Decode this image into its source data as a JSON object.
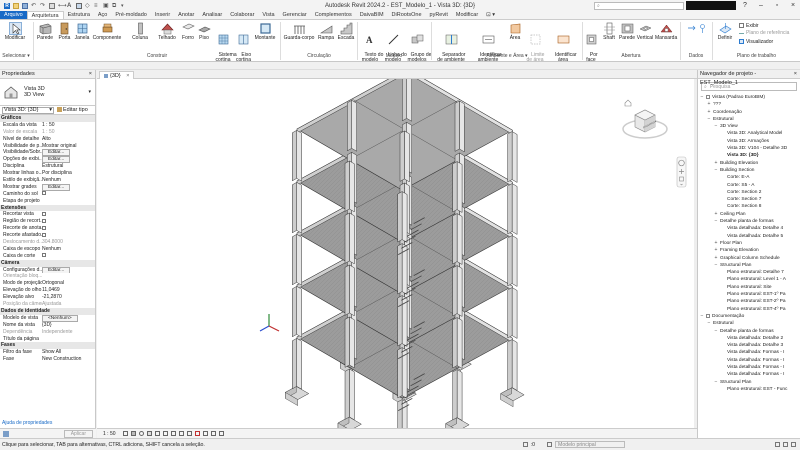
{
  "app": {
    "title": "Autodesk Revit 2024.2 - EST_Modelo_1 - Vista 3D: {3D}",
    "search_placeholder": "",
    "accent": "#1769c6"
  },
  "tabs": [
    {
      "label": "Arquivo"
    },
    {
      "label": "Arquitetura"
    },
    {
      "label": "Estrutura"
    },
    {
      "label": "Aço"
    },
    {
      "label": "Pré-moldado"
    },
    {
      "label": "Inserir"
    },
    {
      "label": "Anotar"
    },
    {
      "label": "Analisar"
    },
    {
      "label": "Colaborar"
    },
    {
      "label": "Vista"
    },
    {
      "label": "Gerenciar"
    },
    {
      "label": "Complementos"
    },
    {
      "label": "DaivaBIM"
    },
    {
      "label": "DiRootsOne"
    },
    {
      "label": "pyRevit"
    },
    {
      "label": "Modificar"
    },
    {
      "label": "⊡ ▾"
    }
  ],
  "ribbon": {
    "select_btn": "Modificar",
    "select_panel": "Selecionar ▾",
    "build": {
      "label": "Construir",
      "wall": "Parede",
      "door": "Porta",
      "window": "Janela",
      "component": "Componente",
      "column": "Coluna",
      "roof": "Telhado",
      "ceiling": "Forro",
      "floor": "Piso",
      "curtain_system": "Sistema\ncortina",
      "curtain_grid": "Eixo\ncortina",
      "mullion": "Montante"
    },
    "circulation": {
      "label": "Circulação",
      "railing": "Guarda-corpo",
      "ramp": "Rampa",
      "stair": "Escada"
    },
    "model": {
      "label": "Modelo",
      "model_text": "Texto do\nmodelo",
      "model_line": "Linha do\nmodelo",
      "model_group": "Grupo de\nmodelos"
    },
    "room": {
      "label": "Ambiente e Área ▾",
      "room_separator": "Separador\nde ambiente",
      "tag_room": "Identificar\nambiente",
      "area": "Área",
      "area_boundary": "Limite\nde área",
      "tag_area": "Identificar\nárea"
    },
    "opening": {
      "label": "Abertura",
      "by_face": "Por\nface",
      "shaft": "Shaft",
      "wall": "Parede",
      "vertical": "Vertical",
      "dormer": "Mansarda"
    },
    "datum": {
      "label": "Dados"
    },
    "workplane": {
      "label": "Plano de trabalho",
      "set": "Definir",
      "show": "Exibir",
      "ref_plane": "Plano de referência",
      "viewer": "Visualizador"
    }
  },
  "properties": {
    "title": "Propriedades",
    "type_name": "Vista 3D",
    "type_sub": "3D View",
    "view_selector": "Vista 3D: {3D}",
    "edit_type": "Editar tipo",
    "rows": [
      {
        "kind": "group",
        "k": "Gráficos",
        "v": ""
      },
      {
        "kind": "text",
        "k": "Escala da vista",
        "v": "1 : 50"
      },
      {
        "kind": "dim",
        "k": "Valor de escala",
        "v": "1 : 50"
      },
      {
        "kind": "text",
        "k": "Nível de detalhe",
        "v": "Alto"
      },
      {
        "kind": "text",
        "k": "Visibilidade de p...",
        "v": "Mostrar original"
      },
      {
        "kind": "btn",
        "k": "Visibilidade/Sobr...",
        "v": "Editar..."
      },
      {
        "kind": "btn",
        "k": "Opções de exibi...",
        "v": "Editar..."
      },
      {
        "kind": "text",
        "k": "Disciplina",
        "v": "Estrutural"
      },
      {
        "kind": "text",
        "k": "Mostrar linhas o...",
        "v": "Por disciplina"
      },
      {
        "kind": "text",
        "k": "Estilo de exibiçã...",
        "v": "Nenhum"
      },
      {
        "kind": "btn",
        "k": "Mostrar grades",
        "v": "Editar..."
      },
      {
        "kind": "chk",
        "k": "Caminho do sol",
        "v": ""
      },
      {
        "kind": "text",
        "k": "Etapa de projeto",
        "v": ""
      },
      {
        "kind": "group",
        "k": "Extensões",
        "v": ""
      },
      {
        "kind": "chk",
        "k": "Recortar vista",
        "v": ""
      },
      {
        "kind": "chk",
        "k": "Região de recort...",
        "v": ""
      },
      {
        "kind": "chk",
        "k": "Recorte de anota...",
        "v": ""
      },
      {
        "kind": "chk",
        "k": "Recorte afastado...",
        "v": ""
      },
      {
        "kind": "dim",
        "k": "Deslocamento d...",
        "v": "304.8000"
      },
      {
        "kind": "text",
        "k": "Caixa de escopo",
        "v": "Nenhum"
      },
      {
        "kind": "chk",
        "k": "Caixa de corte",
        "v": ""
      },
      {
        "kind": "group",
        "k": "Câmera",
        "v": ""
      },
      {
        "kind": "btn",
        "k": "Configurações d...",
        "v": "Editar..."
      },
      {
        "kind": "dim",
        "k": "Orientação bloq...",
        "v": ""
      },
      {
        "kind": "text",
        "k": "Modo de projeção",
        "v": "Ortogonal"
      },
      {
        "kind": "text",
        "k": "Elevação do olho",
        "v": "11,0469"
      },
      {
        "kind": "text",
        "k": "Elevação alvo",
        "v": "-21,2870"
      },
      {
        "kind": "dim",
        "k": "Posição da câmera",
        "v": "Ajustada"
      },
      {
        "kind": "group",
        "k": "Dados de identidade",
        "v": ""
      },
      {
        "kind": "btn",
        "k": "Modelo de vista",
        "v": "<Nenhum>"
      },
      {
        "kind": "text",
        "k": "Nome da vista",
        "v": "{3D}"
      },
      {
        "kind": "dim",
        "k": "Dependência",
        "v": "Independente"
      },
      {
        "kind": "text",
        "k": "Título da página",
        "v": ""
      },
      {
        "kind": "group",
        "k": "Fases",
        "v": ""
      },
      {
        "kind": "text",
        "k": "Filtro da fase",
        "v": "Show All"
      },
      {
        "kind": "text",
        "k": "Fase",
        "v": "New Construction"
      }
    ],
    "help": "Ajuda de propriedades",
    "apply": "Aplicar"
  },
  "canvas": {
    "tab_label": "{3D}",
    "viewcube_label": "ESQUERDA"
  },
  "browser": {
    "title": "Navegador de projeto - EST_Modelo_1",
    "search_placeholder": "Pesquisa",
    "items": [
      {
        "indent": 0,
        "toggle": "−",
        "label": "Vistas (Padrao EuroBIM)",
        "sel": false
      },
      {
        "indent": 1,
        "toggle": "+",
        "label": "???",
        "sel": false
      },
      {
        "indent": 1,
        "toggle": "+",
        "label": "Coordenação",
        "sel": false
      },
      {
        "indent": 1,
        "toggle": "−",
        "label": "Estrutural",
        "sel": false
      },
      {
        "indent": 2,
        "toggle": "−",
        "label": "3D View",
        "sel": false
      },
      {
        "indent": 3,
        "toggle": "",
        "label": "Vista 3D: Analytical Model",
        "sel": false
      },
      {
        "indent": 3,
        "toggle": "",
        "label": "Vista 3D: Armações",
        "sel": false
      },
      {
        "indent": 3,
        "toggle": "",
        "label": "Vista 3D: V104 - Detalhe 3D",
        "sel": false
      },
      {
        "indent": 3,
        "toggle": "",
        "label": "Vista 3D: {3D}",
        "sel": true
      },
      {
        "indent": 2,
        "toggle": "+",
        "label": "Building Elevation",
        "sel": false
      },
      {
        "indent": 2,
        "toggle": "−",
        "label": "Building Section",
        "sel": false
      },
      {
        "indent": 3,
        "toggle": "",
        "label": "Corte: E-A",
        "sel": false
      },
      {
        "indent": 3,
        "toggle": "",
        "label": "Corte: S5 - A",
        "sel": false
      },
      {
        "indent": 3,
        "toggle": "",
        "label": "Corte: Section 2",
        "sel": false
      },
      {
        "indent": 3,
        "toggle": "",
        "label": "Corte: Section 7",
        "sel": false
      },
      {
        "indent": 3,
        "toggle": "",
        "label": "Corte: Section 8",
        "sel": false
      },
      {
        "indent": 2,
        "toggle": "+",
        "label": "Ceiling Plan",
        "sel": false
      },
      {
        "indent": 2,
        "toggle": "−",
        "label": "Detalhe planta de formas",
        "sel": false
      },
      {
        "indent": 3,
        "toggle": "",
        "label": "Vista detalhada: Detalhe 4",
        "sel": false
      },
      {
        "indent": 3,
        "toggle": "",
        "label": "Vista detalhada: Detalhe 5",
        "sel": false
      },
      {
        "indent": 2,
        "toggle": "+",
        "label": "Floor Plan",
        "sel": false
      },
      {
        "indent": 2,
        "toggle": "+",
        "label": "Framing Elevation",
        "sel": false
      },
      {
        "indent": 2,
        "toggle": "+",
        "label": "Graphical Column Schedule",
        "sel": false
      },
      {
        "indent": 2,
        "toggle": "−",
        "label": "Structural Plan",
        "sel": false
      },
      {
        "indent": 3,
        "toggle": "",
        "label": "Plano estrutural: Detalhe 7",
        "sel": false
      },
      {
        "indent": 3,
        "toggle": "",
        "label": "Plano estrutural: Level 1 - A",
        "sel": false
      },
      {
        "indent": 3,
        "toggle": "",
        "label": "Plano estrutural: Site",
        "sel": false
      },
      {
        "indent": 3,
        "toggle": "",
        "label": "Plano estrutural: EST-1º Pa",
        "sel": false
      },
      {
        "indent": 3,
        "toggle": "",
        "label": "Plano estrutural: EST-2º Pa",
        "sel": false
      },
      {
        "indent": 3,
        "toggle": "",
        "label": "Plano estrutural: EST-4º Pa",
        "sel": false
      },
      {
        "indent": 0,
        "toggle": "−",
        "label": "Documentação",
        "sel": false
      },
      {
        "indent": 1,
        "toggle": "−",
        "label": "Estrutural",
        "sel": false
      },
      {
        "indent": 2,
        "toggle": "−",
        "label": "Detalhe planta de formas",
        "sel": false
      },
      {
        "indent": 3,
        "toggle": "",
        "label": "Vista detalhada: Detalhe 2",
        "sel": false
      },
      {
        "indent": 3,
        "toggle": "",
        "label": "Vista detalhada: Detalhe 3",
        "sel": false
      },
      {
        "indent": 3,
        "toggle": "",
        "label": "Vista detalhada: Formas - I",
        "sel": false
      },
      {
        "indent": 3,
        "toggle": "",
        "label": "Vista detalhada: Formas - I",
        "sel": false
      },
      {
        "indent": 3,
        "toggle": "",
        "label": "Vista detalhada: Formas - I",
        "sel": false
      },
      {
        "indent": 3,
        "toggle": "",
        "label": "Vista detalhada: Formas - I",
        "sel": false
      },
      {
        "indent": 2,
        "toggle": "−",
        "label": "Structural Plan",
        "sel": false
      },
      {
        "indent": 3,
        "toggle": "",
        "label": "Plano estrutural: EST - Func",
        "sel": false
      }
    ]
  },
  "view_control": {
    "scale": "1 : 50"
  },
  "status": {
    "message": "Clique para selecionar, TAB para alternativas, CTRL adiciona, SHIFT cancela a seleção.",
    "zero": ":0",
    "model": "Modelo principal"
  }
}
